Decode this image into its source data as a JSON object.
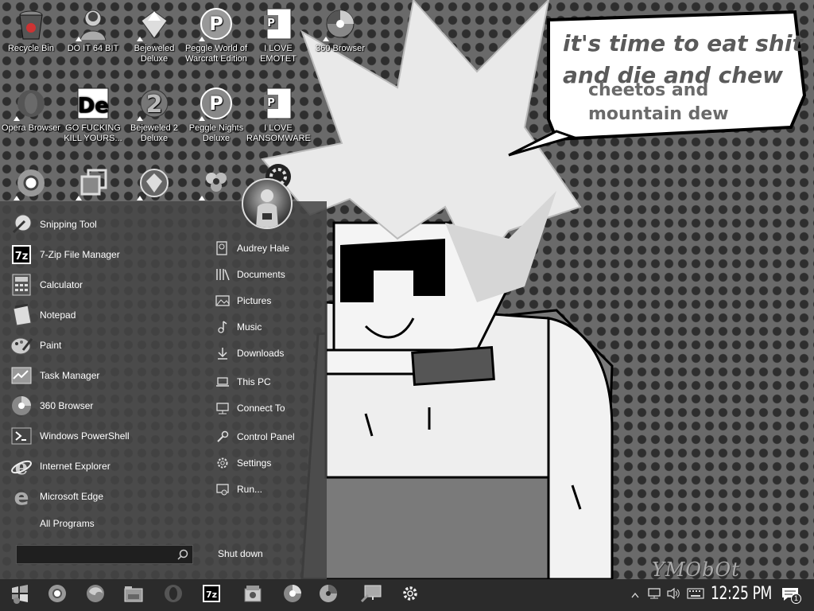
{
  "wallpaper": {
    "bubble_lines": [
      "it's time to eat shit",
      "and die and chew",
      "cheetos and",
      "mountain dew"
    ],
    "signature": "YMObOt"
  },
  "desktop_icons": [
    {
      "label": "Recycle Bin",
      "icon": "recycle-bin-icon"
    },
    {
      "label": "DO IT 64 BIT",
      "icon": "portrait-icon"
    },
    {
      "label": "Bejeweled Deluxe",
      "icon": "gem-icon"
    },
    {
      "label": "Peggle World of Warcraft Edition",
      "icon": "peggle-icon"
    },
    {
      "label": "I LOVE EMOTET",
      "icon": "powerpoint-icon"
    },
    {
      "label": "360 Browser",
      "icon": "browser-360-icon"
    },
    {
      "label": "Opera Browser",
      "icon": "opera-icon"
    },
    {
      "label": "GO FUCKING KILL YOURS...",
      "icon": "de-logo-icon"
    },
    {
      "label": "Bejeweled 2 Deluxe",
      "icon": "gem-2-icon"
    },
    {
      "label": "Peggle Nights Deluxe",
      "icon": "peggle-nights-icon"
    },
    {
      "label": "I LOVE RANSOMWARE",
      "icon": "powerpoint-icon"
    },
    {
      "label": "",
      "icon": "chrome-icon"
    },
    {
      "label": "",
      "icon": "window-stack-icon"
    },
    {
      "label": "",
      "icon": "diamond-icon"
    },
    {
      "label": "",
      "icon": "flower-icon"
    },
    {
      "label": "",
      "icon": "gear-app-icon"
    }
  ],
  "start_menu": {
    "programs": [
      {
        "label": "Snipping Tool",
        "icon": "snipping-tool-icon"
      },
      {
        "label": "7-Zip File Manager",
        "icon": "7zip-icon"
      },
      {
        "label": "Calculator",
        "icon": "calculator-icon"
      },
      {
        "label": "Notepad",
        "icon": "notepad-icon"
      },
      {
        "label": "Paint",
        "icon": "paint-icon"
      },
      {
        "label": "Task Manager",
        "icon": "task-manager-icon"
      },
      {
        "label": "360 Browser",
        "icon": "browser-360-icon"
      },
      {
        "label": "Windows PowerShell",
        "icon": "powershell-icon"
      },
      {
        "label": "Internet Explorer",
        "icon": "internet-explorer-icon"
      },
      {
        "label": "Microsoft Edge",
        "icon": "edge-icon"
      }
    ],
    "all_programs": "All Programs",
    "search_value": "",
    "places": [
      {
        "label": "Audrey Hale",
        "icon": "user-folder-icon"
      },
      {
        "label": "Documents",
        "icon": "library-icon"
      },
      {
        "label": "Pictures",
        "icon": "picture-icon"
      },
      {
        "label": "Music",
        "icon": "music-note-icon"
      },
      {
        "label": "Downloads",
        "icon": "download-icon"
      },
      {
        "label": "This PC",
        "icon": "laptop-icon"
      },
      {
        "label": "Connect To",
        "icon": "network-icon"
      },
      {
        "label": "Control Panel",
        "icon": "wrench-icon"
      },
      {
        "label": "Settings",
        "icon": "gear-icon"
      },
      {
        "label": "Run...",
        "icon": "run-icon"
      }
    ],
    "shutdown": "Shut down"
  },
  "taskbar": {
    "pinned": [
      "start-icon",
      "chrome-icon",
      "firefox-icon",
      "file-explorer-icon",
      "opera-icon",
      "7zip-icon",
      "media-icon",
      "browser-360-icon",
      "disc-icon",
      "remote-desktop-icon",
      "gear-icon"
    ],
    "clock": "12:25 PM",
    "notification_count": "1"
  }
}
